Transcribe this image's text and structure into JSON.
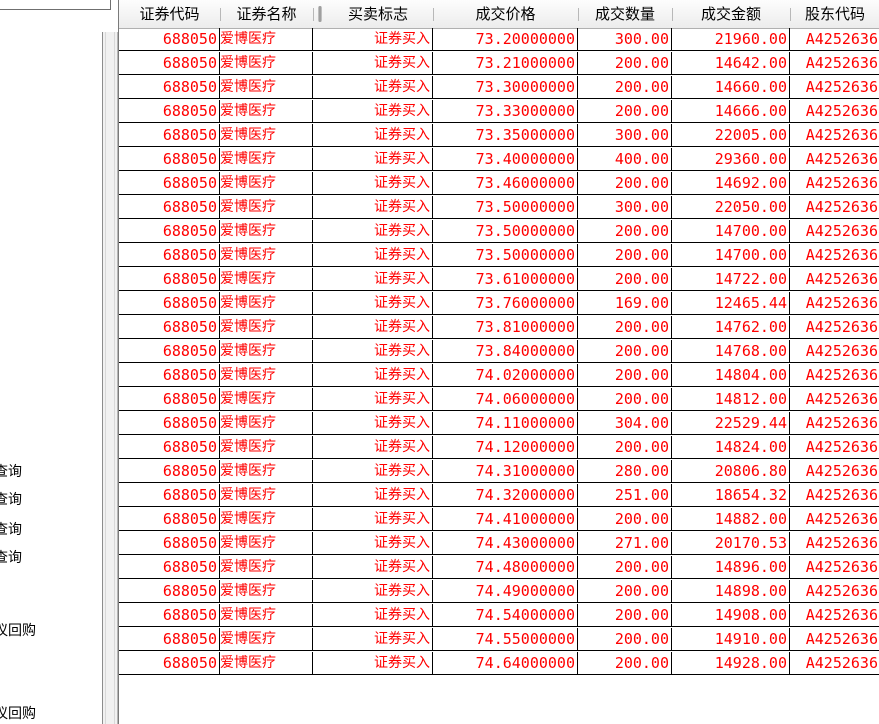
{
  "left_panel": {
    "items": [
      {
        "label": "查询"
      },
      {
        "label": "查询"
      },
      {
        "label": "查询"
      },
      {
        "label": "查询"
      },
      {
        "label": "议回购"
      },
      {
        "label": "议回购"
      }
    ]
  },
  "table": {
    "columns": [
      {
        "label": "证券代码"
      },
      {
        "label": "证券名称"
      },
      {
        "label": "买卖标志"
      },
      {
        "label": "成交价格"
      },
      {
        "label": "成交数量"
      },
      {
        "label": "成交金额"
      },
      {
        "label": "股东代码"
      }
    ],
    "rows": [
      [
        "688050",
        "爱博医疗",
        "证券买入",
        "73.20000000",
        "300.00",
        "21960.00",
        "A4252636"
      ],
      [
        "688050",
        "爱博医疗",
        "证券买入",
        "73.21000000",
        "200.00",
        "14642.00",
        "A4252636"
      ],
      [
        "688050",
        "爱博医疗",
        "证券买入",
        "73.30000000",
        "200.00",
        "14660.00",
        "A4252636"
      ],
      [
        "688050",
        "爱博医疗",
        "证券买入",
        "73.33000000",
        "200.00",
        "14666.00",
        "A4252636"
      ],
      [
        "688050",
        "爱博医疗",
        "证券买入",
        "73.35000000",
        "300.00",
        "22005.00",
        "A4252636"
      ],
      [
        "688050",
        "爱博医疗",
        "证券买入",
        "73.40000000",
        "400.00",
        "29360.00",
        "A4252636"
      ],
      [
        "688050",
        "爱博医疗",
        "证券买入",
        "73.46000000",
        "200.00",
        "14692.00",
        "A4252636"
      ],
      [
        "688050",
        "爱博医疗",
        "证券买入",
        "73.50000000",
        "300.00",
        "22050.00",
        "A4252636"
      ],
      [
        "688050",
        "爱博医疗",
        "证券买入",
        "73.50000000",
        "200.00",
        "14700.00",
        "A4252636"
      ],
      [
        "688050",
        "爱博医疗",
        "证券买入",
        "73.50000000",
        "200.00",
        "14700.00",
        "A4252636"
      ],
      [
        "688050",
        "爱博医疗",
        "证券买入",
        "73.61000000",
        "200.00",
        "14722.00",
        "A4252636"
      ],
      [
        "688050",
        "爱博医疗",
        "证券买入",
        "73.76000000",
        "169.00",
        "12465.44",
        "A4252636"
      ],
      [
        "688050",
        "爱博医疗",
        "证券买入",
        "73.81000000",
        "200.00",
        "14762.00",
        "A4252636"
      ],
      [
        "688050",
        "爱博医疗",
        "证券买入",
        "73.84000000",
        "200.00",
        "14768.00",
        "A4252636"
      ],
      [
        "688050",
        "爱博医疗",
        "证券买入",
        "74.02000000",
        "200.00",
        "14804.00",
        "A4252636"
      ],
      [
        "688050",
        "爱博医疗",
        "证券买入",
        "74.06000000",
        "200.00",
        "14812.00",
        "A4252636"
      ],
      [
        "688050",
        "爱博医疗",
        "证券买入",
        "74.11000000",
        "304.00",
        "22529.44",
        "A4252636"
      ],
      [
        "688050",
        "爱博医疗",
        "证券买入",
        "74.12000000",
        "200.00",
        "14824.00",
        "A4252636"
      ],
      [
        "688050",
        "爱博医疗",
        "证券买入",
        "74.31000000",
        "280.00",
        "20806.80",
        "A4252636"
      ],
      [
        "688050",
        "爱博医疗",
        "证券买入",
        "74.32000000",
        "251.00",
        "18654.32",
        "A4252636"
      ],
      [
        "688050",
        "爱博医疗",
        "证券买入",
        "74.41000000",
        "200.00",
        "14882.00",
        "A4252636"
      ],
      [
        "688050",
        "爱博医疗",
        "证券买入",
        "74.43000000",
        "271.00",
        "20170.53",
        "A4252636"
      ],
      [
        "688050",
        "爱博医疗",
        "证券买入",
        "74.48000000",
        "200.00",
        "14896.00",
        "A4252636"
      ],
      [
        "688050",
        "爱博医疗",
        "证券买入",
        "74.49000000",
        "200.00",
        "14898.00",
        "A4252636"
      ],
      [
        "688050",
        "爱博医疗",
        "证券买入",
        "74.54000000",
        "200.00",
        "14908.00",
        "A4252636"
      ],
      [
        "688050",
        "爱博医疗",
        "证券买入",
        "74.55000000",
        "200.00",
        "14910.00",
        "A4252636"
      ],
      [
        "688050",
        "爱博医疗",
        "证券买入",
        "74.64000000",
        "200.00",
        "14928.00",
        "A4252636"
      ]
    ]
  },
  "colors": {
    "row_text": "#ff0000",
    "grid_line": "#000000",
    "header_text": "#000000"
  }
}
